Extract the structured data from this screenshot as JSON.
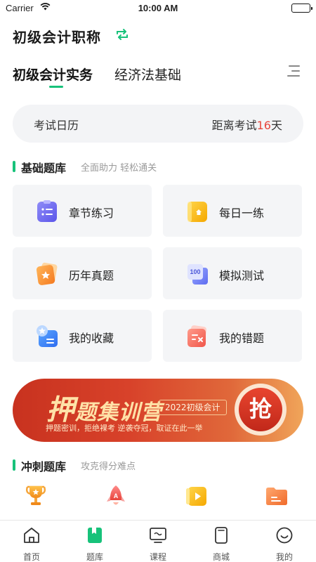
{
  "status_bar": {
    "carrier": "Carrier",
    "time": "10:00 AM"
  },
  "header": {
    "title": "初级会计职称",
    "switch_icon": "switch-icon"
  },
  "tabs": [
    {
      "label": "初级会计实务",
      "active": true
    },
    {
      "label": "经济法基础",
      "active": false
    }
  ],
  "exam_card": {
    "label": "考试日历",
    "countdown_prefix": "距离考试",
    "days": "16",
    "countdown_suffix": "天"
  },
  "basic_section": {
    "title": "基础题库",
    "subtitle": "全面助力 轻松通关",
    "items": [
      {
        "label": "章节练习",
        "icon": "chapter-practice-icon"
      },
      {
        "label": "每日一练",
        "icon": "daily-practice-icon"
      },
      {
        "label": "历年真题",
        "icon": "past-exams-icon"
      },
      {
        "label": "模拟测试",
        "icon": "mock-test-icon"
      },
      {
        "label": "我的收藏",
        "icon": "favorites-icon"
      },
      {
        "label": "我的错题",
        "icon": "wrong-questions-icon"
      }
    ]
  },
  "banner": {
    "title_first": "押",
    "title_rest": "题集训营",
    "year_tag": "2022初级会计",
    "slogan": "押题密训，拒绝裸考  逆袭夺冠，取证在此一举",
    "button": "抢"
  },
  "sprint_section": {
    "title": "冲刺题库",
    "subtitle": "攻克得分难点",
    "icons": [
      "trophy-icon",
      "rocket-icon",
      "video-icon",
      "folder-icon"
    ]
  },
  "bottom_nav": [
    {
      "label": "首页",
      "icon": "home-icon"
    },
    {
      "label": "题库",
      "icon": "question-bank-icon",
      "active": true
    },
    {
      "label": "课程",
      "icon": "course-icon"
    },
    {
      "label": "商城",
      "icon": "mall-icon"
    },
    {
      "label": "我的",
      "icon": "profile-icon"
    }
  ],
  "colors": {
    "accent": "#17c27a",
    "countdown": "#e8453c",
    "banner_red": "#c8321f",
    "banner_orange": "#f0a55a"
  }
}
